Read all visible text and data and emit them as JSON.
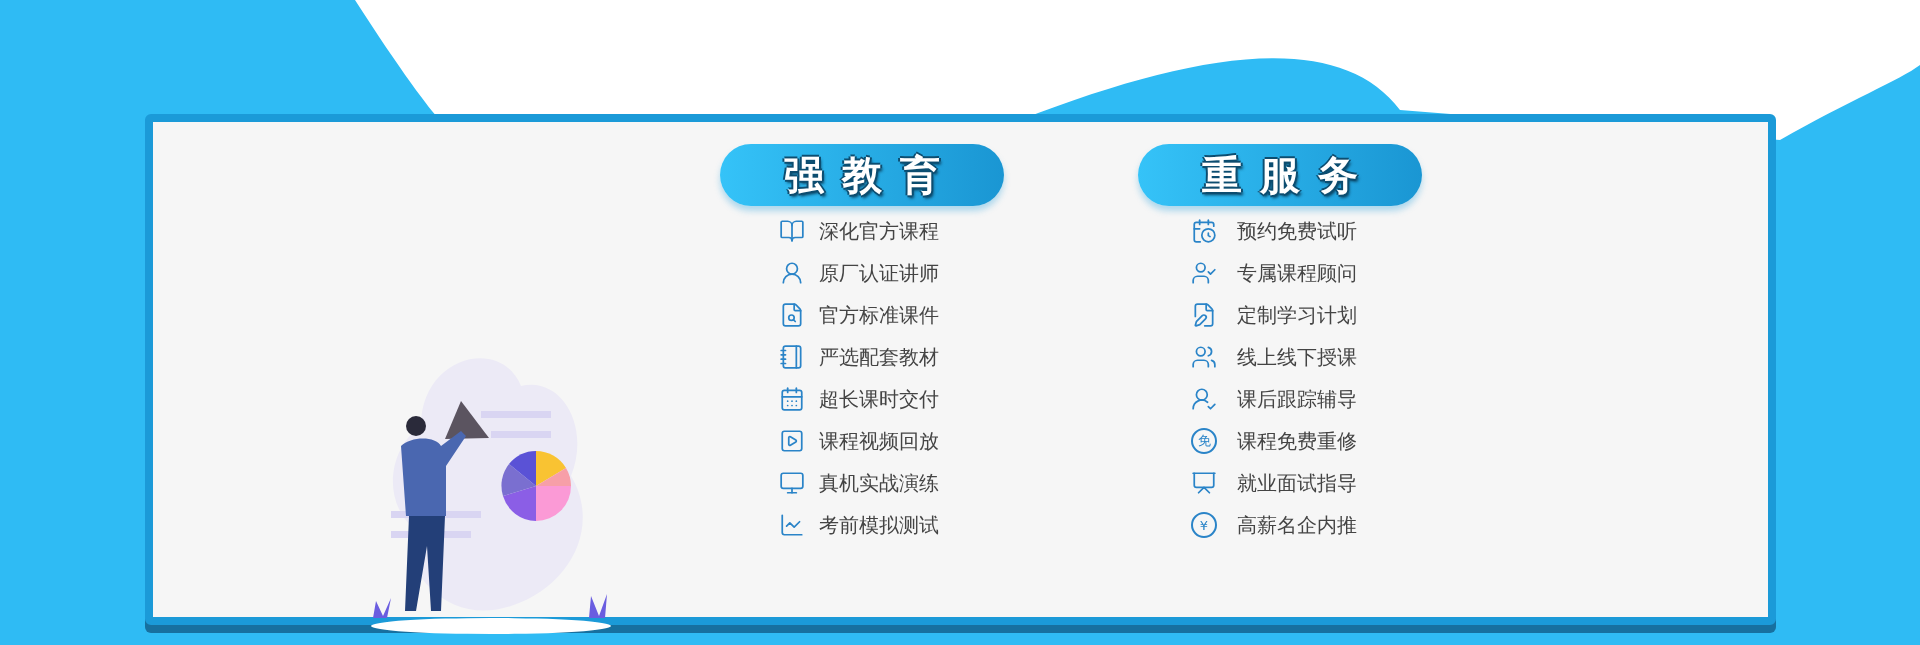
{
  "columns": [
    {
      "title": "强教育",
      "items": [
        {
          "label": "深化官方课程"
        },
        {
          "label": "原厂认证讲师"
        },
        {
          "label": "官方标准课件"
        },
        {
          "label": "严选配套教材"
        },
        {
          "label": "超长课时交付"
        },
        {
          "label": "课程视频回放"
        },
        {
          "label": "真机实战演练"
        },
        {
          "label": "考前模拟测试"
        }
      ]
    },
    {
      "title": "重服务",
      "items": [
        {
          "label": "预约免费试听"
        },
        {
          "label": "专属课程顾问"
        },
        {
          "label": "定制学习计划"
        },
        {
          "label": "线上线下授课"
        },
        {
          "label": "课后跟踪辅导"
        },
        {
          "label": "课程免费重修",
          "badge": "免"
        },
        {
          "label": "就业面试指导"
        },
        {
          "label": "高薪名企内推",
          "badge": "¥"
        }
      ]
    }
  ]
}
